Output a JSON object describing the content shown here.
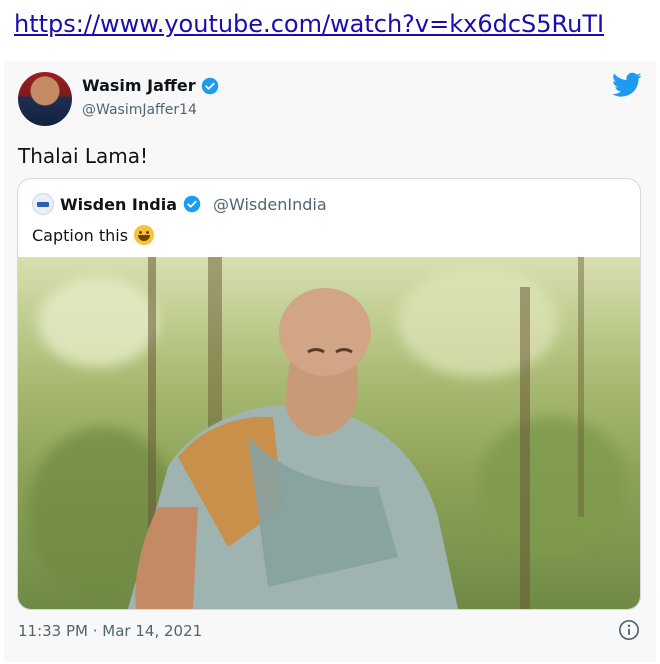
{
  "link": {
    "url_text": "https://www.youtube.com/watch?v=kx6dcS5RuTI"
  },
  "tweet": {
    "author_name": "Wasim Jaffer",
    "author_handle": "@WasimJaffer14",
    "text": "Thalai Lama!",
    "timestamp": "11:33 PM · Mar 14, 2021",
    "quoted": {
      "name": "Wisden India",
      "handle": "@WisdenIndia",
      "text": "Caption this",
      "emoji": "grinning-face-emoji"
    }
  },
  "icons": {
    "verified": "verified-badge-icon",
    "brand": "twitter-bird-icon",
    "info": "info-icon"
  },
  "colors": {
    "link": "#1a0dab",
    "twitter_blue": "#1d9bf0",
    "muted_text": "#536471"
  }
}
